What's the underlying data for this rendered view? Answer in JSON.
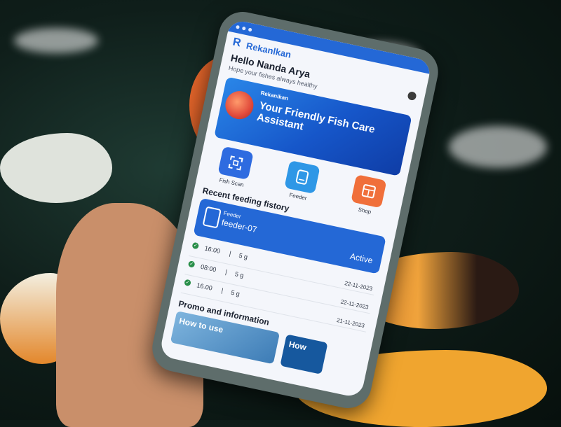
{
  "app": {
    "name": "Rekanlkan",
    "logo_icon": "rekanikan-logo-icon"
  },
  "greeting": {
    "title": "Hello Nanda Arya",
    "subtitle": "Hope your fishes always healthy",
    "profile_icon": "profile-icon"
  },
  "banner": {
    "brand": "Rekanikan",
    "headline": "Your Friendly Fish Care Assistant"
  },
  "quick_actions": [
    {
      "label": "Fish Scan",
      "icon": "scan-icon",
      "color": "#2e6be0"
    },
    {
      "label": "Feeder",
      "icon": "feeder-icon",
      "color": "#2e97e6"
    },
    {
      "label": "Shop",
      "icon": "shop-icon",
      "color": "#f06f3a"
    }
  ],
  "feeding": {
    "section_title": "Recent feeding fistory",
    "card": {
      "small_label": "Feeder",
      "name": "feeder-07",
      "status": "Active"
    },
    "history": [
      {
        "time": "16:00",
        "amount": "5 g",
        "date": "22-11-2023"
      },
      {
        "time": "08:00",
        "amount": "5 g",
        "date": "22-11-2023"
      },
      {
        "time": "16.00",
        "amount": "5 g",
        "date": "21-11-2023"
      }
    ]
  },
  "promo": {
    "section_title": "Promo and information",
    "cards": [
      {
        "label": "How to use"
      },
      {
        "label": "How"
      }
    ]
  },
  "colors": {
    "primary": "#2468d6",
    "accent": "#f06f3a",
    "success": "#2a8f4a"
  }
}
